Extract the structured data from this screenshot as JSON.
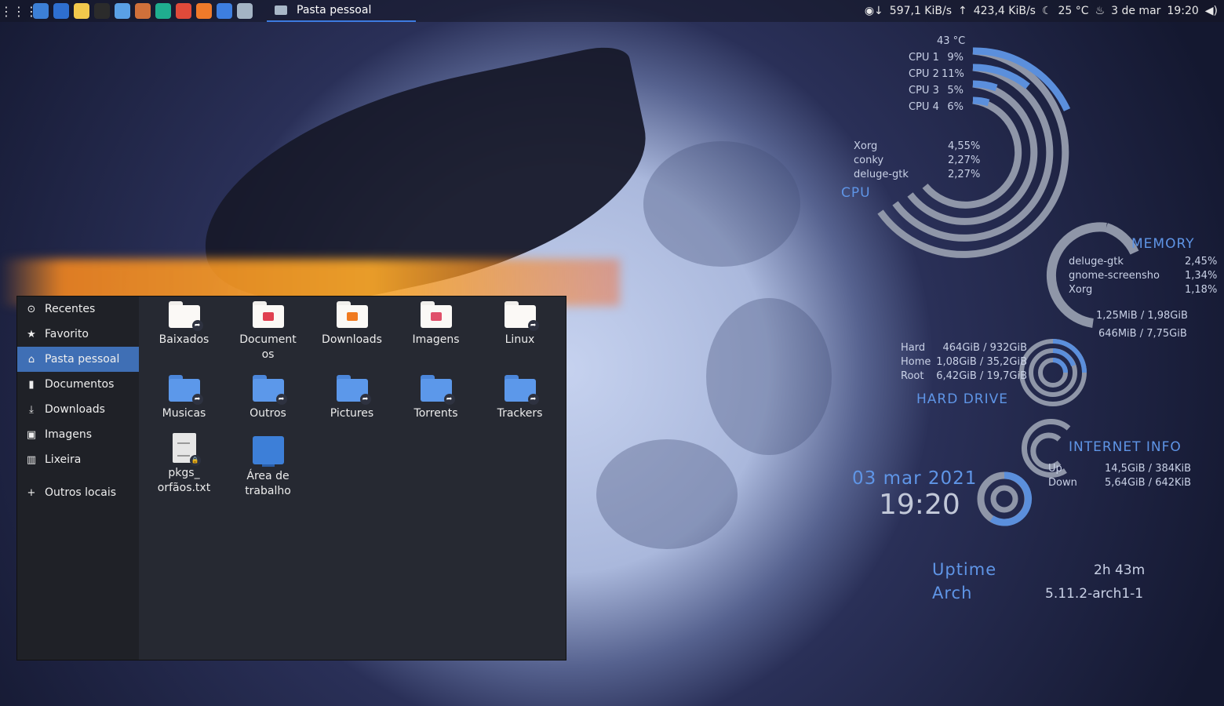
{
  "panel": {
    "launcher_icon": "app-grid-icon",
    "apps": [
      {
        "name": "settings-icon",
        "color": "#3c7fd6"
      },
      {
        "name": "system-monitor-icon",
        "color": "#2e6fd0"
      },
      {
        "name": "text-editor-icon",
        "color": "#f2c94c"
      },
      {
        "name": "terminal-icon",
        "color": "#2b2b2b"
      },
      {
        "name": "cloud-app-icon",
        "color": "#5aa0e6"
      },
      {
        "name": "cleaner-icon",
        "color": "#d0703a"
      },
      {
        "name": "edge-browser-icon",
        "color": "#1fae8f"
      },
      {
        "name": "chrome-browser-icon",
        "color": "#e04a3a"
      },
      {
        "name": "firefox-browser-icon",
        "color": "#f07a2a"
      },
      {
        "name": "deluge-icon",
        "color": "#3d7ee0"
      },
      {
        "name": "file-manager-icon",
        "color": "#a4b4c4"
      }
    ],
    "task_label": "Pasta pessoal",
    "net_down": "597,1 KiB/s",
    "net_up": "423,4 KiB/s",
    "weather": "25 °C",
    "date": "3 de mar",
    "time": "19:20"
  },
  "file_manager": {
    "sidebar": [
      {
        "icon": "clock-icon",
        "glyph": "⊙",
        "label": "Recentes"
      },
      {
        "icon": "star-icon",
        "glyph": "★",
        "label": "Favorito"
      },
      {
        "icon": "home-icon",
        "glyph": "⌂",
        "label": "Pasta pessoal",
        "active": true
      },
      {
        "icon": "document-icon",
        "glyph": "▮",
        "label": "Documentos"
      },
      {
        "icon": "download-icon",
        "glyph": "⤓",
        "label": "Downloads"
      },
      {
        "icon": "image-icon",
        "glyph": "▣",
        "label": "Imagens"
      },
      {
        "icon": "trash-icon",
        "glyph": "▥",
        "label": "Lixeira"
      }
    ],
    "other_locations": {
      "icon": "plus-icon",
      "glyph": "+",
      "label": "Outros locais"
    },
    "items_row1": [
      {
        "label": "Baixados",
        "color": "#f5f5f5",
        "badge": "➦"
      },
      {
        "label": "Documentos",
        "color": "#f5f5f5",
        "inner": "#e04050"
      },
      {
        "label": "Downloads",
        "color": "#f5f5f5",
        "inner": "#f07a20"
      },
      {
        "label": "Imagens",
        "color": "#f5f5f5",
        "inner": "#e0506a"
      },
      {
        "label": "Linux",
        "color": "#f5f5f5",
        "badge": "➦"
      }
    ],
    "items_row2": [
      {
        "label": "Musicas"
      },
      {
        "label": "Outros"
      },
      {
        "label": "Pictures"
      },
      {
        "label": "Torrents"
      },
      {
        "label": "Trackers"
      }
    ],
    "file_txt": "pkgs_\norfãos.txt",
    "desktop_folder": "Área de\ntrabalho"
  },
  "conky": {
    "cpu_temp": "43 °C",
    "cpus": [
      {
        "label": "CPU 1",
        "value": "9%"
      },
      {
        "label": "CPU 2",
        "value": "11%"
      },
      {
        "label": "CPU 3",
        "value": "5%"
      },
      {
        "label": "CPU 4",
        "value": "6%"
      }
    ],
    "cpu_procs": [
      {
        "name": "Xorg",
        "value": "4,55%"
      },
      {
        "name": "conky",
        "value": "2,27%"
      },
      {
        "name": "deluge-gtk",
        "value": "2,27%"
      }
    ],
    "cpu_title": "CPU",
    "memory_title": "MEMORY",
    "mem_procs": [
      {
        "name": "deluge-gtk",
        "value": "2,45%"
      },
      {
        "name": "gnome-screensho",
        "value": "1,34%"
      },
      {
        "name": "Xorg",
        "value": "1,18%"
      }
    ],
    "swap": "1,25MiB / 1,98GiB",
    "ram": "646MiB / 7,75GiB",
    "disks": [
      {
        "name": "Hard",
        "value": "464GiB / 932GiB"
      },
      {
        "name": "Home",
        "value": "1,08GiB / 35,2GiB"
      },
      {
        "name": "Root",
        "value": "6,42GiB / 19,7GiB"
      }
    ],
    "hd_title": "HARD DRIVE",
    "net_title": "INTERNET INFO",
    "net": [
      {
        "name": "Up",
        "value": "14,5GiB / 384KiB"
      },
      {
        "name": "Down",
        "value": "5,64GiB / 642KiB"
      }
    ],
    "date": "03 mar 2021",
    "time": "19:20",
    "uptime_label": "Uptime",
    "uptime_value": "2h 43m",
    "os_label": "Arch",
    "kernel": "5.11.2-arch1-1",
    "accent": "#5f95e6"
  }
}
